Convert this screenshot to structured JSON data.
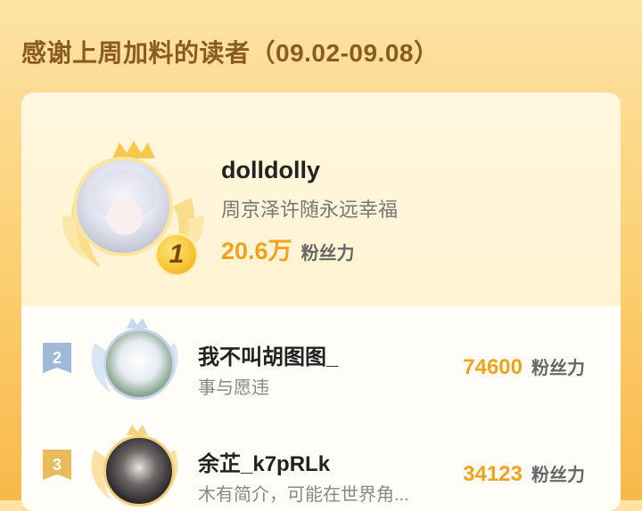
{
  "header": {
    "title": "感谢上周加料的读者（09.02-09.08）"
  },
  "top": {
    "rank": "1",
    "name": "dolldolly",
    "bio": "周京泽许随永远幸福",
    "fans_num": "20.6万",
    "fans_unit": "粉丝力"
  },
  "list": [
    {
      "rank": "2",
      "name": "我不叫胡图图_",
      "bio": "事与愿违",
      "fans_num": "74600",
      "fans_unit": "粉丝力"
    },
    {
      "rank": "3",
      "name": "余芷_k7pRLk",
      "bio": "木有简介，可能在世界角...",
      "fans_num": "34123",
      "fans_unit": "粉丝力"
    }
  ],
  "colors": {
    "accent": "#f0a21c",
    "title": "#8a5a1f",
    "rank2": "#9fb9d6",
    "rank3": "#e9bb5a"
  }
}
